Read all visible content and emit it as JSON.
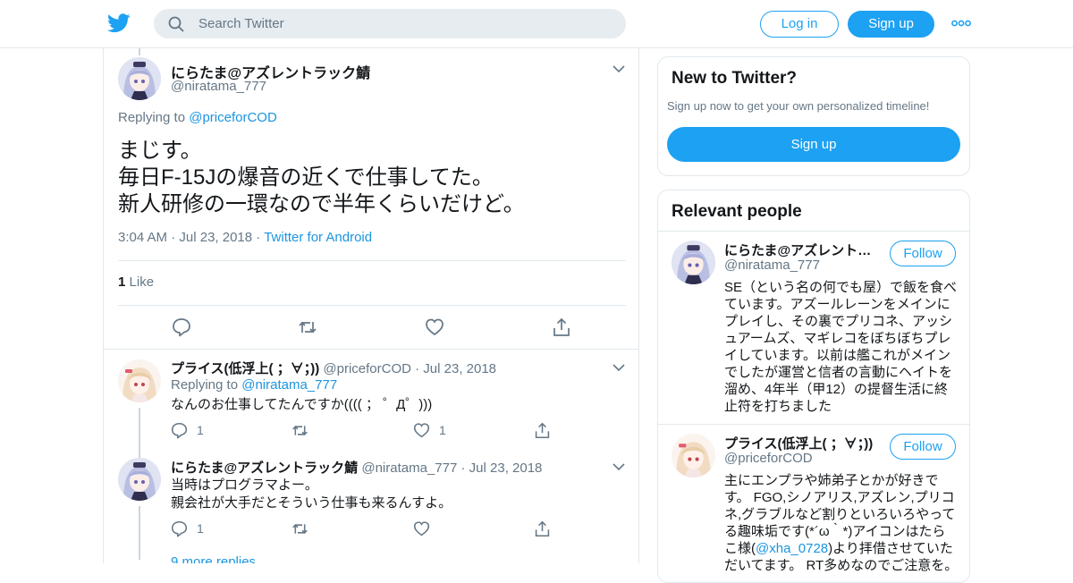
{
  "header": {
    "search_placeholder": "Search Twitter",
    "login_label": "Log in",
    "signup_label": "Sign up"
  },
  "main_tweet": {
    "author_name": "にらたま@アズレントラック鯖",
    "author_handle": "@niratama_777",
    "replying_prefix": "Replying to",
    "replying_to": "@priceforCOD",
    "text_lines": [
      "まじす。",
      "毎日F-15Jの爆音の近くで仕事してた。",
      "新人研修の一環なので半年くらいだけど。"
    ],
    "time": "3:04 AM",
    "date": "Jul 23, 2018",
    "source": "Twitter for Android",
    "like_count": "1",
    "like_label": "Like"
  },
  "replies": [
    {
      "author_name": "プライス(低浮上( ；∀；))",
      "author_handle": "@priceforCOD",
      "date": "Jul 23, 2018",
      "replying_prefix": "Replying to",
      "replying_to": "@niratama_777",
      "text_lines": [
        "なんのお仕事してたんですか(((( ； ゜Д゜)))"
      ],
      "reply_count": "1",
      "like_count": "1"
    },
    {
      "author_name": "にらたま@アズレントラック鯖",
      "author_handle": "@niratama_777",
      "date": "Jul 23, 2018",
      "text_lines": [
        "当時はプログラマよー。",
        "親会社が大手だとそういう仕事も来るんすよ。"
      ],
      "reply_count": "1"
    }
  ],
  "more_replies": "9 more replies",
  "sidebar": {
    "new_title": "New to Twitter?",
    "new_sub": "Sign up now to get your own personalized timeline!",
    "new_signup": "Sign up",
    "relevant_title": "Relevant people",
    "follow_label": "Follow",
    "people": [
      {
        "name": "にらたま@アズレントラック鯖",
        "handle": "@niratama_777",
        "bio": "SE（という名の何でも屋）で飯を食べています。アズールレーンをメインにプレイし、その裏でプリコネ、アッシュアームズ、マギレコをぼちぼちプレイしています。以前は艦これがメインでしたが運営と信者の言動にヘイトを溜め、4年半（甲12）の提督生活に終止符を打ちました"
      },
      {
        "name": "プライス(低浮上( ；∀；))",
        "handle": "@priceforCOD",
        "bio_before": "主にエンプラや姉弟子とかが好きです。 FGO,シノアリス,アズレン,プリコネ,グラブルなど割りといろいろやってる趣味垢です(*´ω｀*)アイコンはたらこ様(",
        "bio_link": "@xha_0728",
        "bio_after": ")より拝借させていただいてます。 RT多めなのでご注意を。"
      }
    ]
  },
  "colors": {
    "accent": "#1da1f2",
    "link": "#1b95e0",
    "secondary_text": "#657786",
    "border": "#e1e8ed"
  }
}
